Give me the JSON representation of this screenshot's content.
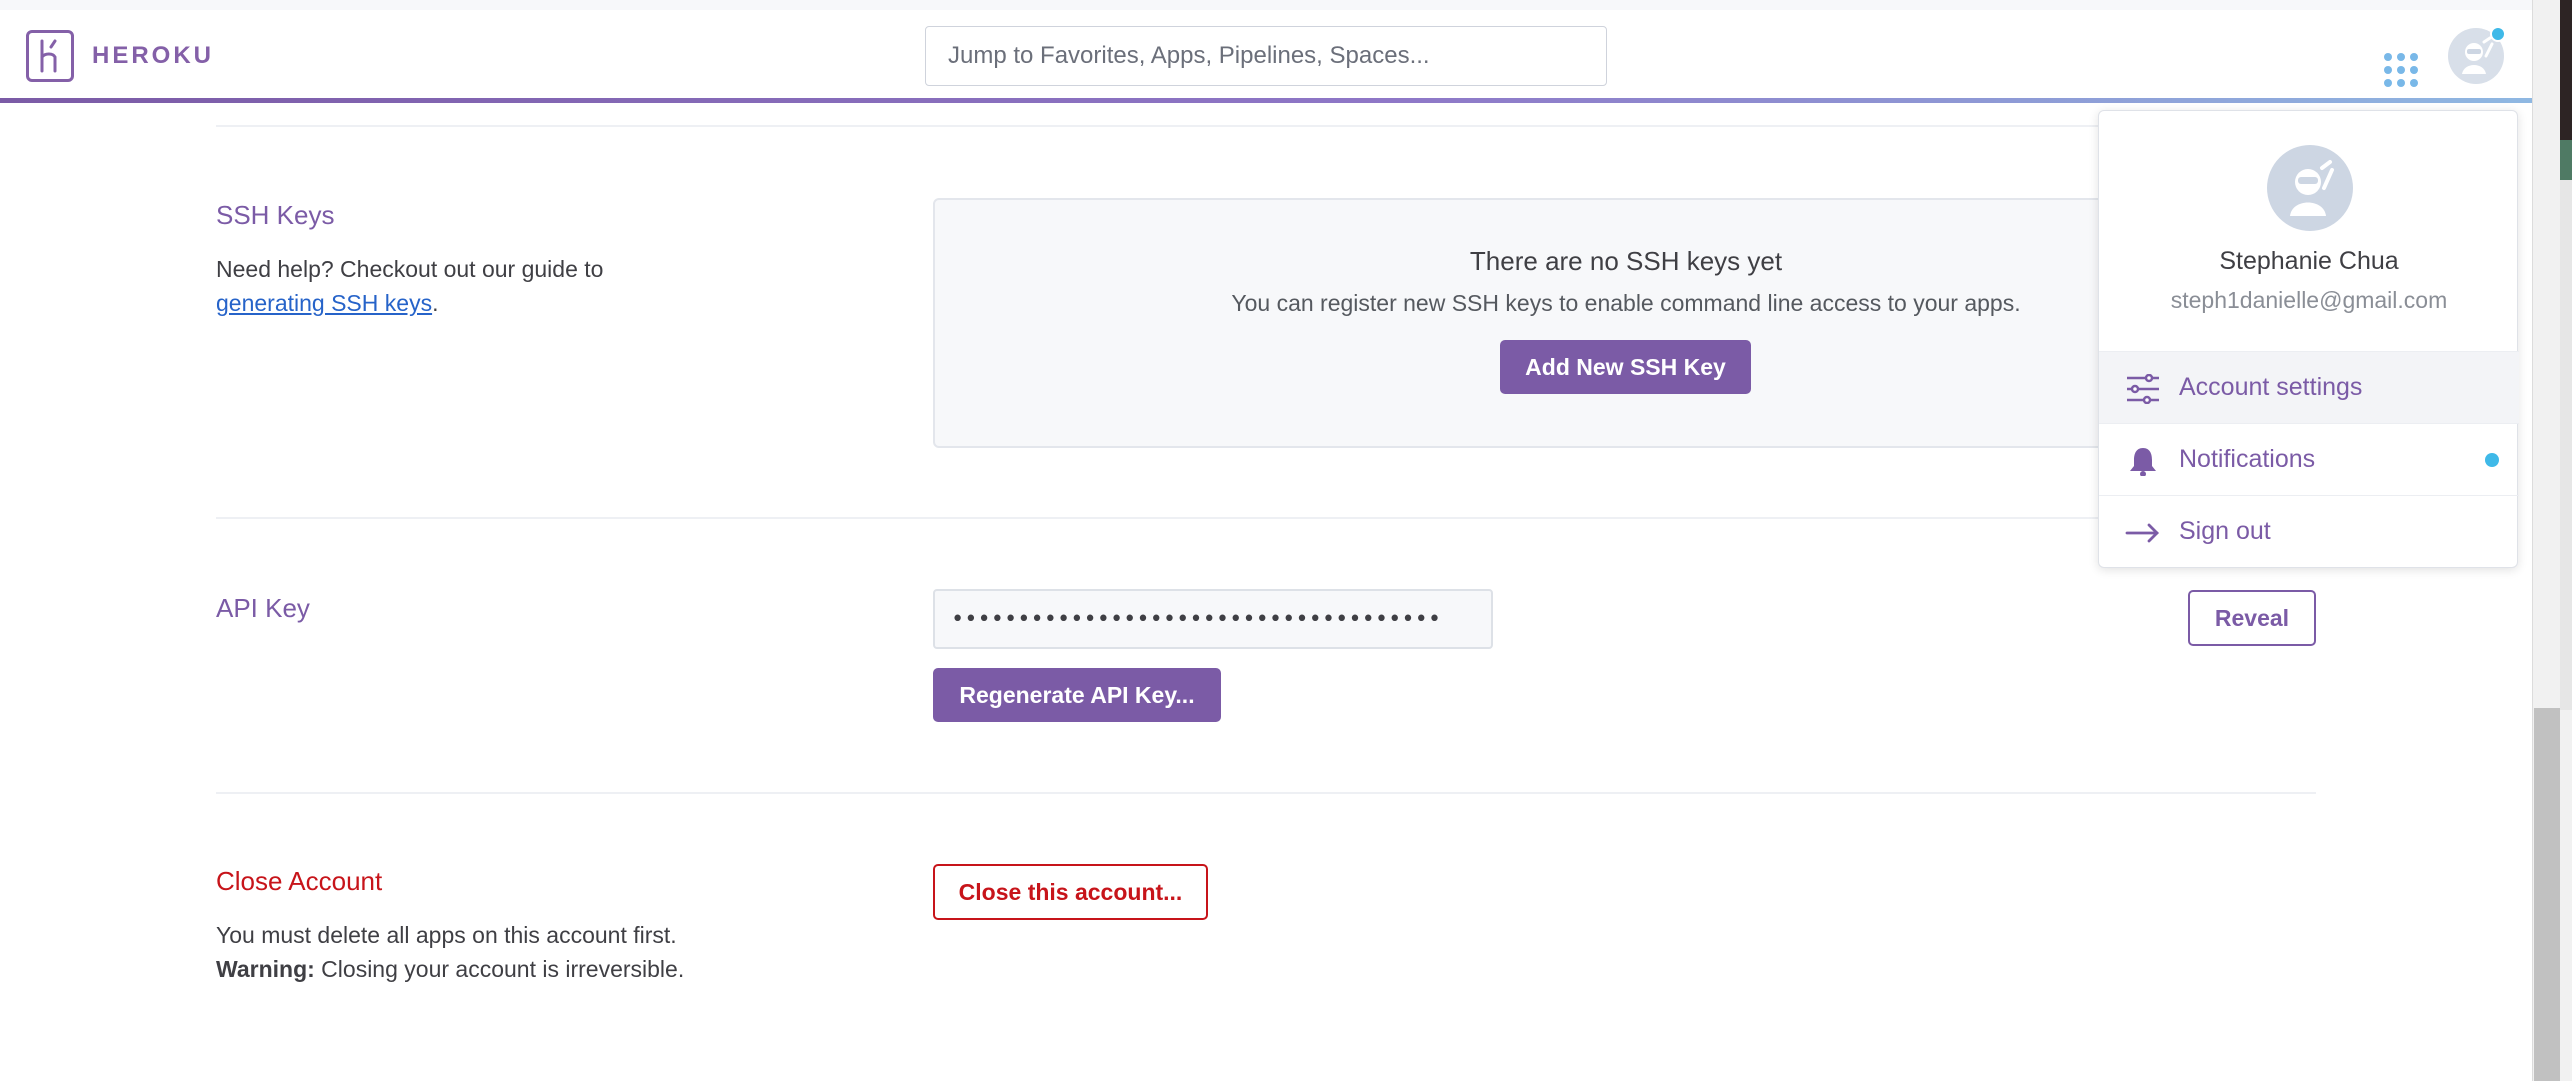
{
  "header": {
    "brand": "HEROKU",
    "search_placeholder": "Jump to Favorites, Apps, Pipelines, Spaces..."
  },
  "ssh": {
    "title": "SSH Keys",
    "help_prefix": "Need help? Checkout out our guide to",
    "help_link": "generating SSH keys",
    "help_suffix": ".",
    "empty_title": "There are no SSH keys yet",
    "empty_desc": "You can register new SSH keys to enable command line access to your apps.",
    "add_button": "Add New SSH Key"
  },
  "api": {
    "title": "API Key",
    "masked_value": "•••••••••••••••••••••••••••••••••••••",
    "reveal_button": "Reveal",
    "regenerate_button": "Regenerate API Key..."
  },
  "close_account": {
    "title": "Close Account",
    "desc": "You must delete all apps on this account first.",
    "warning_label": "Warning:",
    "warning_text": " Closing your account is irreversible.",
    "button": "Close this account..."
  },
  "account_menu": {
    "name": "Stephanie Chua",
    "email": "steph1danielle@gmail.com",
    "items": [
      {
        "label": "Account settings",
        "icon": "sliders-icon",
        "active": true
      },
      {
        "label": "Notifications",
        "icon": "bell-icon",
        "has_dot": true
      },
      {
        "label": "Sign out",
        "icon": "arrow-right-icon"
      }
    ]
  },
  "colors": {
    "brand_purple": "#7b5ba6",
    "danger_red": "#c7141a",
    "notification_blue": "#3fb9e8",
    "link_blue": "#2663c9"
  }
}
